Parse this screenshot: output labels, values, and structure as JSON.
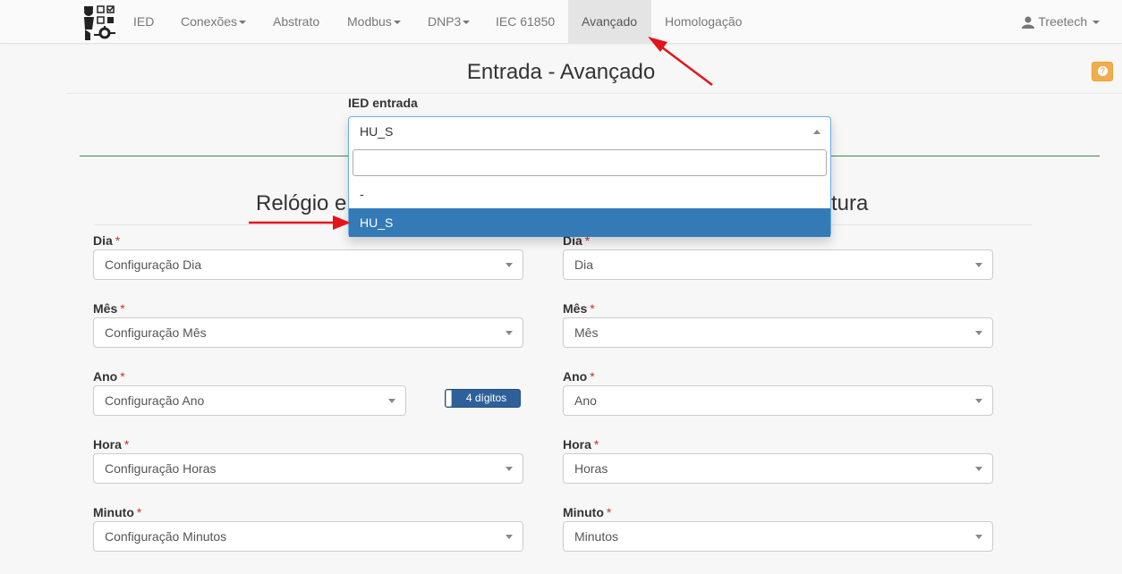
{
  "nav": {
    "items": [
      {
        "label": "IED",
        "caret": false
      },
      {
        "label": "Conexões",
        "caret": true
      },
      {
        "label": "Abstrato",
        "caret": false
      },
      {
        "label": "Modbus",
        "caret": true
      },
      {
        "label": "DNP3",
        "caret": true
      },
      {
        "label": "IEC 61850",
        "caret": false
      },
      {
        "label": "Avançado",
        "caret": false,
        "active": true
      },
      {
        "label": "Homologação",
        "caret": false
      }
    ],
    "user": "Treetech"
  },
  "page": {
    "title": "Entrada - Avançado",
    "help_icon": "?"
  },
  "ied_entrada": {
    "label": "IED entrada",
    "value": "HU_S",
    "search_placeholder": "",
    "options": [
      "-",
      "HU_S"
    ],
    "highlighted": "HU_S"
  },
  "section": {
    "title_left": "Relógio e",
    "title_right": "tura"
  },
  "left_fields": [
    {
      "label": "Dia",
      "value": "Configuração Dia"
    },
    {
      "label": "Mês",
      "value": "Configuração Mês"
    },
    {
      "label": "Ano",
      "value": "Configuração Ano"
    },
    {
      "label": "Hora",
      "value": "Configuração Horas"
    },
    {
      "label": "Minuto",
      "value": "Configuração Minutos"
    }
  ],
  "right_fields": [
    {
      "label": "Dia",
      "value": "Dia"
    },
    {
      "label": "Mês",
      "value": "Mês"
    },
    {
      "label": "Ano",
      "value": "Ano"
    },
    {
      "label": "Hora",
      "value": "Horas"
    },
    {
      "label": "Minuto",
      "value": "Minutos"
    }
  ],
  "required_mark": "*",
  "toggle": {
    "label": "4 dígitos"
  },
  "colors": {
    "accent": "#337ab7",
    "annotation_arrow": "#e3151a",
    "divider": "#3c8c3c",
    "help": "#f0ad4e"
  }
}
